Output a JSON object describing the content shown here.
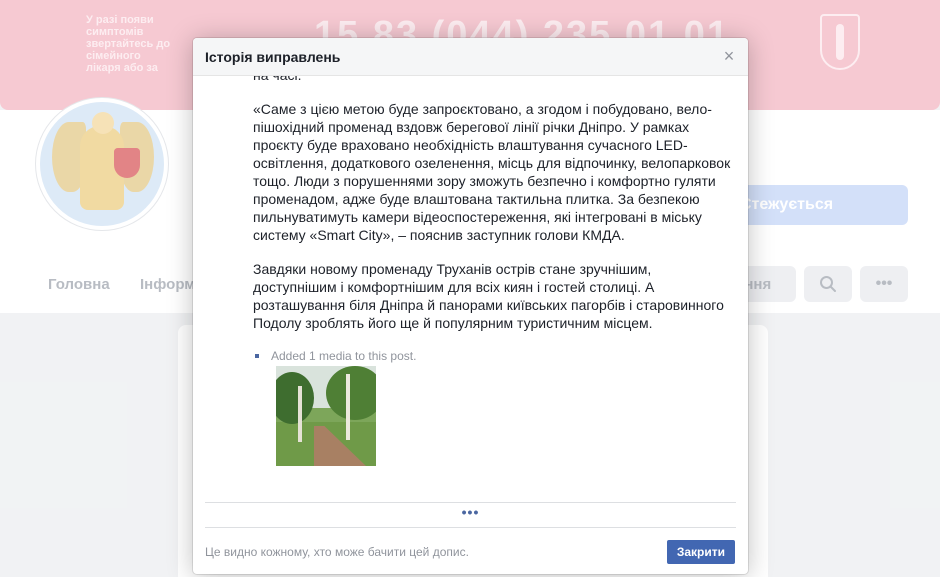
{
  "background": {
    "cover_text": "У разі появи симптомів\nзвертайтесь до сімейного\nлікаря або за",
    "cover_phones": "15  83  (044) 235 01 01",
    "follow_label": "Стежується",
    "tabs": [
      "Головна",
      "Інформ"
    ],
    "tab_right_label": "ення",
    "search_icon": "search-icon",
    "more_icon": "more-icon"
  },
  "modal": {
    "title": "Історія виправлень",
    "close_icon": "×",
    "body": {
      "fragment": "на часі.",
      "paragraph_1": "«Саме з цією метою буде запроєктовано, а згодом і побудовано, вело-пішохідний променад вздовж берегової лінії річки Дніпро. У рамках проєкту буде враховано необхідність влаштування сучасного LED-освітлення, додаткового озеленення, місць для відпочинку, велопарковок тощо. Люди з порушеннями зору зможуть безпечно і комфортно гуляти променадом, адже буде влаштована тактильна плитка. За безпекою пильнуватимуть камери відеоспостереження, які інтегровані в міську систему «Smart City», – пояснив заступник голови КМДА.",
      "paragraph_2": "Завдяки новому променаду Труханів острів стане зручнішим, доступнішим і комфортнішим для всіх киян і гостей столиці. А розташування біля Дніпра й панорами київських пагорбів і старовинного Подолу зроблять його ще й популярним туристичним місцем.",
      "media_note": "Added 1 media to this post."
    },
    "more_dots": "•••",
    "footer_note": "Це видно кожному, хто може бачити цей допис.",
    "close_button": "Закрити"
  },
  "colors": {
    "accent": "#4267b2",
    "cover": "#f0a8b6"
  }
}
